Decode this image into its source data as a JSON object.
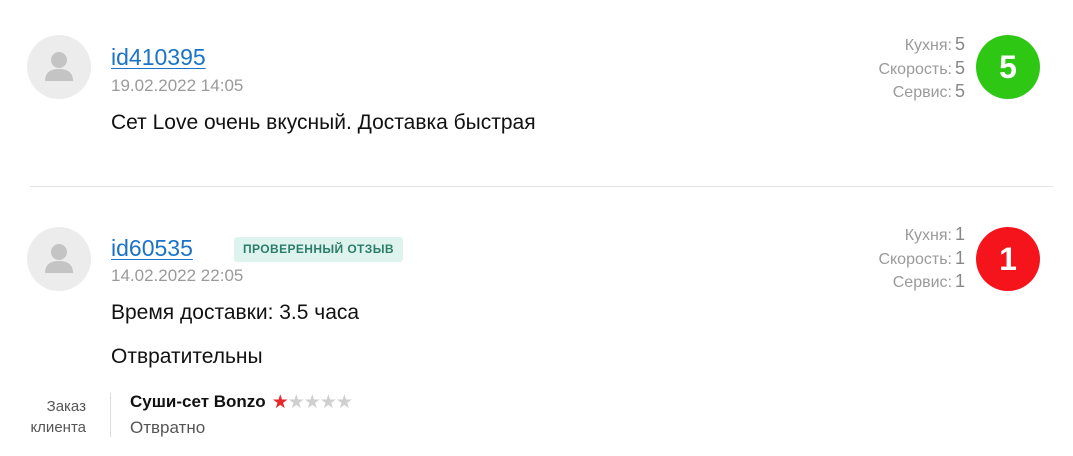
{
  "reviews": [
    {
      "username": "id410395",
      "date": "19.02.2022 14:05",
      "verified_label": "",
      "text_lines": [
        "Сет Love очень вкусный. Доставка быстрая"
      ],
      "ratings": [
        {
          "label": "Кухня:",
          "value": "5"
        },
        {
          "label": "Скорость:",
          "value": "5"
        },
        {
          "label": "Сервис:",
          "value": "5"
        }
      ],
      "score": "5",
      "score_color": "#2ec814"
    },
    {
      "username": "id60535",
      "date": "14.02.2022 22:05",
      "verified_label": "ПРОВЕРЕННЫЙ ОТЗЫВ",
      "text_lines": [
        "Время доставки: 3.5 часа",
        "Отвратительны"
      ],
      "ratings": [
        {
          "label": "Кухня:",
          "value": "1"
        },
        {
          "label": "Скорость:",
          "value": "1"
        },
        {
          "label": "Сервис:",
          "value": "1"
        }
      ],
      "score": "1",
      "score_color": "#f5141c",
      "order": {
        "label_line1": "Заказ",
        "label_line2": "клиента",
        "item_name": "Суши-сет Bonzo",
        "item_rating": 1,
        "item_rating_max": 5,
        "item_comment": "Отвратно"
      }
    }
  ],
  "colors": {
    "link": "#1a73c8",
    "badge_bg": "#dff3ee",
    "badge_text": "#2a7d68",
    "star_filled": "#e8262d",
    "star_empty": "#cfcfcf"
  },
  "icons": {
    "avatar": "user-silhouette-icon",
    "star": "star-icon"
  }
}
